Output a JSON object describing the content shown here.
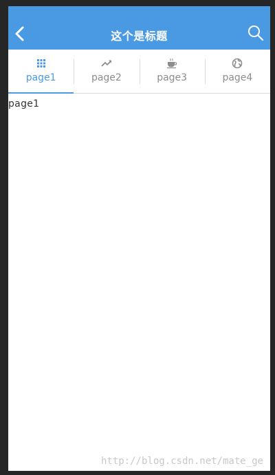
{
  "header": {
    "title": "这个是标题",
    "back_icon": "chevron-left-icon",
    "search_icon": "search-icon",
    "background": "#4a9ae3"
  },
  "tabs": [
    {
      "label": "page1",
      "icon": "grid-icon",
      "active": true
    },
    {
      "label": "page2",
      "icon": "trend-icon",
      "active": false
    },
    {
      "label": "page3",
      "icon": "coffee-icon",
      "active": false
    },
    {
      "label": "page4",
      "icon": "globe-icon",
      "active": false
    }
  ],
  "content": {
    "text": "page1"
  },
  "watermark": "http://blog.csdn.net/mate_ge",
  "colors": {
    "accent": "#4a9ae3",
    "inactive": "#8c8c8c"
  }
}
